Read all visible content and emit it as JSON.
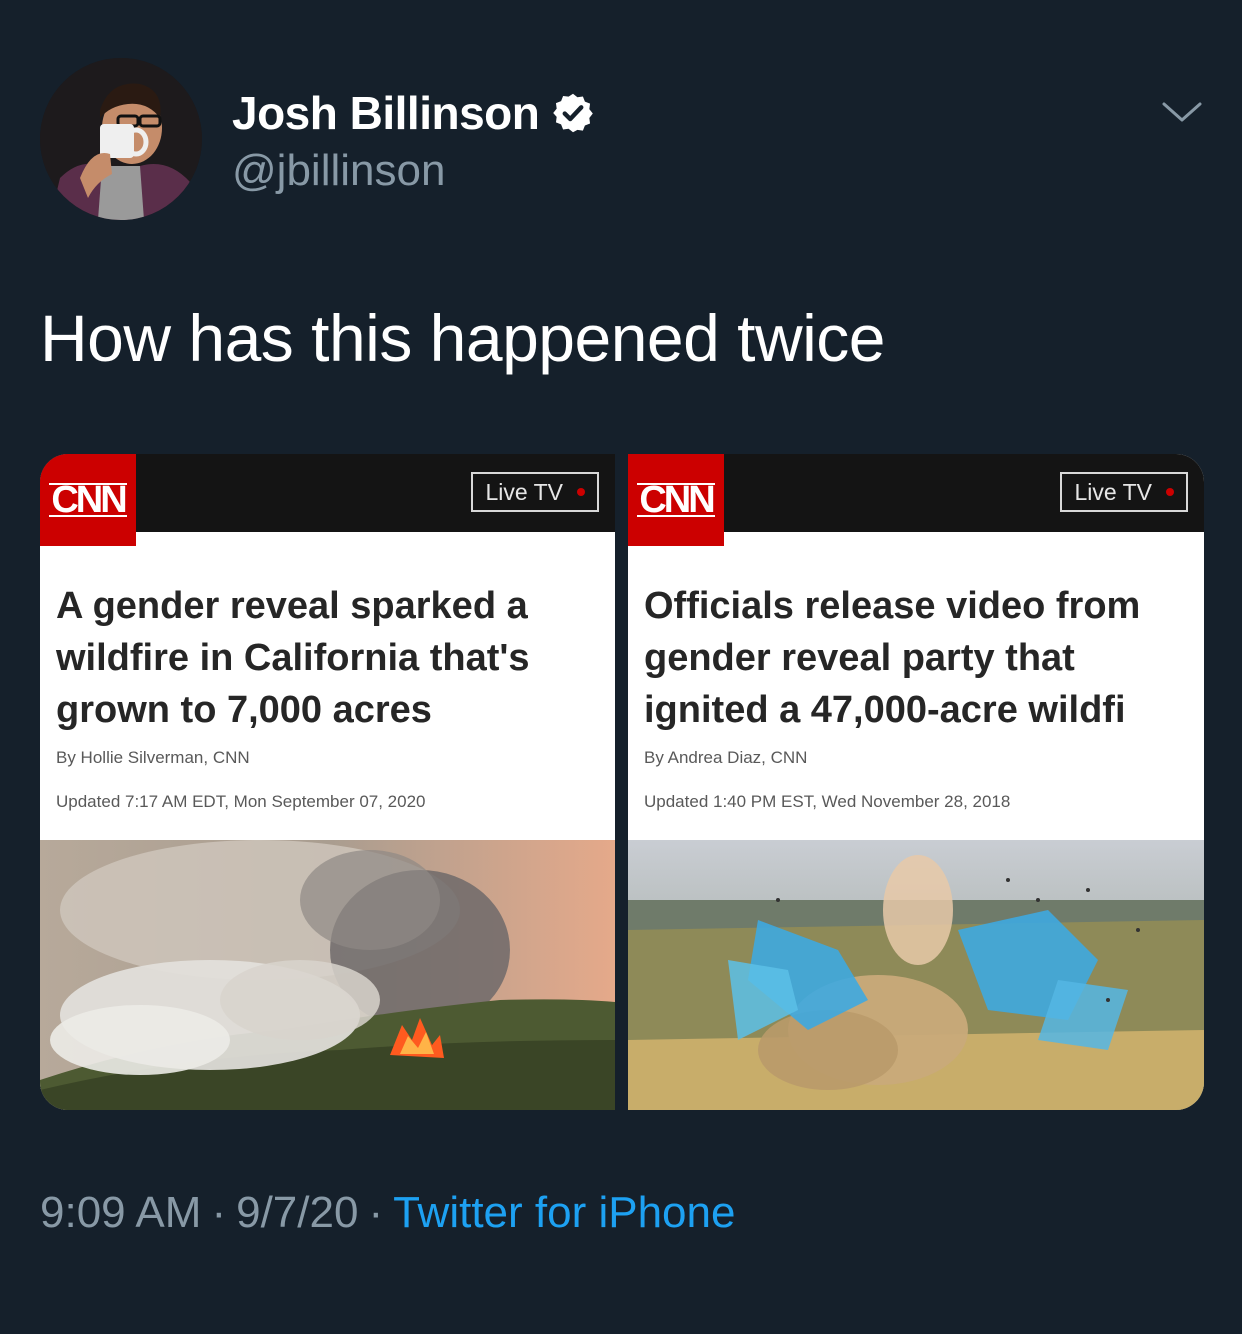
{
  "author": {
    "display_name": "Josh Billinson",
    "handle": "@jbillinson",
    "verified_icon": "verified-badge-icon"
  },
  "tweet": {
    "text": "How has this happened twice"
  },
  "articles": [
    {
      "logo": "CNN",
      "live_tv": "Live TV",
      "headline_lines": [
        "A gender reveal sparked a",
        "wildfire in California that's",
        "grown to 7,000 acres"
      ],
      "byline": "By Hollie Silverman, CNN",
      "updated": "Updated 7:17 AM EDT, Mon September 07, 2020"
    },
    {
      "logo": "CNN",
      "live_tv": "Live TV",
      "headline_lines": [
        "Officials release video from",
        "gender reveal party that",
        "ignited a 47,000-acre wildfi"
      ],
      "byline": "By Andrea Diaz, CNN",
      "updated": "Updated 1:40 PM EST, Wed November 28, 2018"
    }
  ],
  "footer": {
    "time": "9:09 AM",
    "date": "9/7/20",
    "separator": "·",
    "source": "Twitter for iPhone"
  },
  "colors": {
    "background": "#15202b",
    "secondary_text": "#8899a6",
    "link": "#1da1f2",
    "cnn_red": "#cc0000"
  }
}
